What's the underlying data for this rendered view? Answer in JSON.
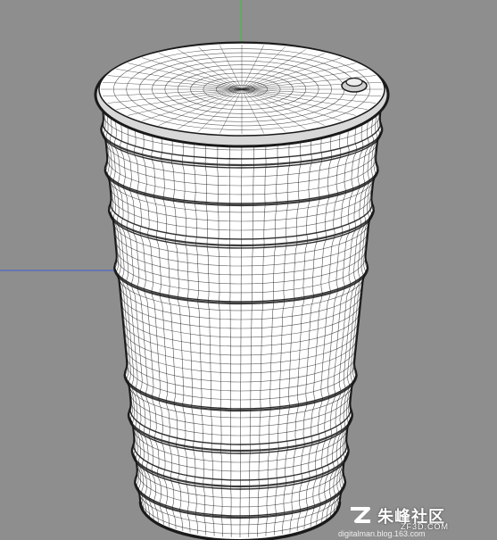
{
  "viewport": {
    "background": "#8e8e8e",
    "axis_y_color": "#3fbf3f",
    "axis_x_color": "#3f5fd0",
    "mesh_fill": "#ffffff",
    "wire_color": "#1a1a1a"
  },
  "object": {
    "name": "oil-drum",
    "cap_icon": "bung-cap-icon"
  },
  "watermark": {
    "logo_icon": "zf-logo-icon",
    "brand_cn": "朱峰社区",
    "brand_en": "ZF3D.COM",
    "url": "digitalman.blog.163.com"
  }
}
